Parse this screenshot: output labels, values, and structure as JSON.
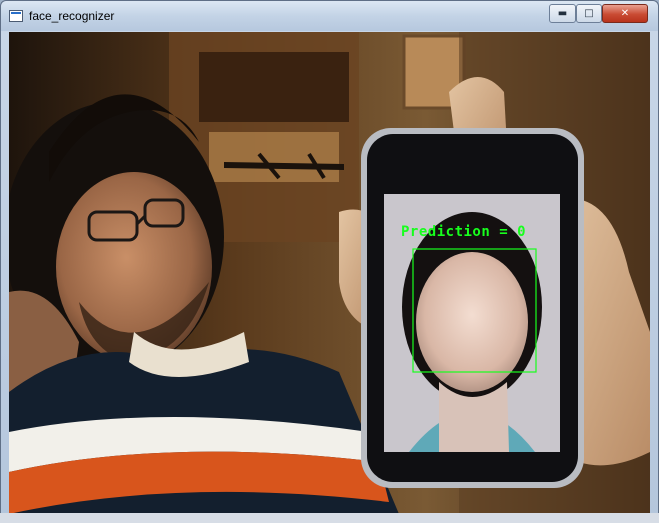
{
  "window": {
    "title": "face_recognizer",
    "buttons": {
      "minimize_icon": "minimize-icon",
      "maximize_icon": "maximize-icon",
      "close_icon": "close-icon"
    }
  },
  "overlay": {
    "prediction_text": "Prediction = 0",
    "color": "#17ff1d"
  }
}
